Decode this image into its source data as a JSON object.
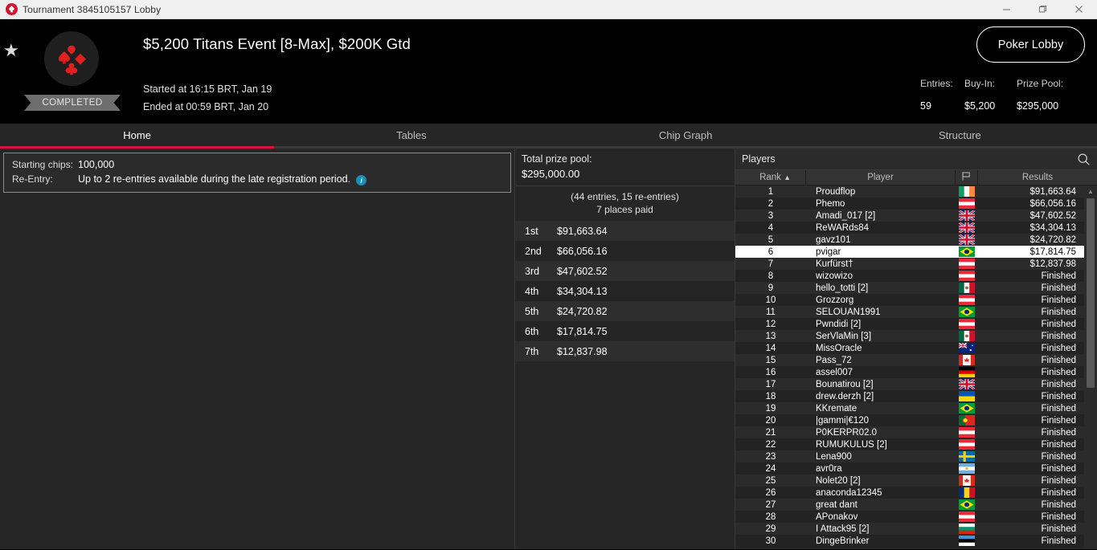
{
  "window": {
    "title": "Tournament 3845105157 Lobby",
    "logo_icon": "pokerstars-spade-icon",
    "controls": [
      {
        "name": "minimize-button",
        "icon": "minimize-icon"
      },
      {
        "name": "maximize-button",
        "icon": "maximize-icon"
      },
      {
        "name": "close-button",
        "icon": "close-icon"
      }
    ]
  },
  "header": {
    "favorite_icon": "star-icon",
    "logo_icon": "card-suits-icon",
    "status_badge": "COMPLETED",
    "title": "$5,200 Titans Event [8-Max], $200K Gtd",
    "started": "Started at 16:15 BRT, Jan 19",
    "ended": "Ended at 00:59 BRT, Jan 20",
    "lobby_button": "Poker Lobby",
    "stats": [
      {
        "label": "Entries:",
        "value": "59"
      },
      {
        "label": "Buy-In:",
        "value": "$5,200"
      },
      {
        "label": "Prize Pool:",
        "value": "$295,000"
      }
    ]
  },
  "tabs": [
    {
      "label": "Home",
      "active": true
    },
    {
      "label": "Tables",
      "active": false
    },
    {
      "label": "Chip Graph",
      "active": false
    },
    {
      "label": "Structure",
      "active": false
    }
  ],
  "info_panel": {
    "rows": [
      {
        "key": "Starting chips:",
        "value": "100,000",
        "info_icon": false
      },
      {
        "key": "Re-Entry:",
        "value": "Up to 2 re-entries available during the late registration period.",
        "info_icon": true
      }
    ],
    "info_icon_name": "info-icon",
    "info_icon_glyph": "i"
  },
  "prize_panel": {
    "total_label": "Total prize pool:",
    "total_value": "$295,000.00",
    "entries_line": "(44 entries, 15 re-entries)",
    "places_line": "7 places paid",
    "rows": [
      {
        "place": "1st",
        "amount": "$91,663.64"
      },
      {
        "place": "2nd",
        "amount": "$66,056.16"
      },
      {
        "place": "3rd",
        "amount": "$47,602.52"
      },
      {
        "place": "4th",
        "amount": "$34,304.13"
      },
      {
        "place": "5th",
        "amount": "$24,720.82"
      },
      {
        "place": "6th",
        "amount": "$17,814.75"
      },
      {
        "place": "7th",
        "amount": "$12,837.98"
      }
    ]
  },
  "players_panel": {
    "title": "Players",
    "search_icon": "search-icon",
    "columns": [
      {
        "label": "Rank",
        "sorted": "asc",
        "sort_icon": "chevron-up-icon"
      },
      {
        "label": "Player"
      },
      {
        "label": "",
        "icon": "flag-icon"
      },
      {
        "label": "Results"
      }
    ],
    "rows": [
      {
        "rank": "1",
        "player": "Proudflop",
        "country": "ie",
        "results": "$91,663.64",
        "selected": false
      },
      {
        "rank": "2",
        "player": "Phemo",
        "country": "at",
        "results": "$66,056.16",
        "selected": false
      },
      {
        "rank": "3",
        "player": "Amadi_017 [2]",
        "country": "gb",
        "results": "$47,602.52",
        "selected": false
      },
      {
        "rank": "4",
        "player": "ReWARds84",
        "country": "gb",
        "results": "$34,304.13",
        "selected": false
      },
      {
        "rank": "5",
        "player": "gavz101",
        "country": "gb",
        "results": "$24,720.82",
        "selected": false
      },
      {
        "rank": "6",
        "player": "pvigar",
        "country": "br",
        "results": "$17,814.75",
        "selected": true
      },
      {
        "rank": "7",
        "player": "Kurfürst†",
        "country": "at",
        "results": "$12,837.98",
        "selected": false
      },
      {
        "rank": "8",
        "player": "wizowizo",
        "country": "at",
        "results": "Finished",
        "selected": false
      },
      {
        "rank": "9",
        "player": "hello_totti [2]",
        "country": "mx",
        "results": "Finished",
        "selected": false
      },
      {
        "rank": "10",
        "player": "Grozzorg",
        "country": "at",
        "results": "Finished",
        "selected": false
      },
      {
        "rank": "11",
        "player": "SELOUAN1991",
        "country": "br",
        "results": "Finished",
        "selected": false
      },
      {
        "rank": "12",
        "player": "Pwndidi [2]",
        "country": "at",
        "results": "Finished",
        "selected": false
      },
      {
        "rank": "13",
        "player": "SerVlaMin [3]",
        "country": "mx",
        "results": "Finished",
        "selected": false
      },
      {
        "rank": "14",
        "player": "MissOracle",
        "country": "au",
        "results": "Finished",
        "selected": false
      },
      {
        "rank": "15",
        "player": "Pass_72",
        "country": "ca",
        "results": "Finished",
        "selected": false
      },
      {
        "rank": "16",
        "player": "assel007",
        "country": "de",
        "results": "Finished",
        "selected": false
      },
      {
        "rank": "17",
        "player": "Bounatirou [2]",
        "country": "gb",
        "results": "Finished",
        "selected": false
      },
      {
        "rank": "18",
        "player": "drew.derzh [2]",
        "country": "ua",
        "results": "Finished",
        "selected": false
      },
      {
        "rank": "19",
        "player": "KKremate",
        "country": "br",
        "results": "Finished",
        "selected": false
      },
      {
        "rank": "20",
        "player": "|gammi|€120",
        "country": "pt",
        "results": "Finished",
        "selected": false
      },
      {
        "rank": "21",
        "player": "P0KERPR02.0",
        "country": "at",
        "results": "Finished",
        "selected": false
      },
      {
        "rank": "22",
        "player": "RUMUKULUS [2]",
        "country": "at",
        "results": "Finished",
        "selected": false
      },
      {
        "rank": "23",
        "player": "Lena900",
        "country": "se",
        "results": "Finished",
        "selected": false
      },
      {
        "rank": "24",
        "player": "avr0ra",
        "country": "ar",
        "results": "Finished",
        "selected": false
      },
      {
        "rank": "25",
        "player": "Nolet20 [2]",
        "country": "ca",
        "results": "Finished",
        "selected": false
      },
      {
        "rank": "26",
        "player": "anaconda12345",
        "country": "ro",
        "results": "Finished",
        "selected": false
      },
      {
        "rank": "27",
        "player": "great dant",
        "country": "br",
        "results": "Finished",
        "selected": false
      },
      {
        "rank": "28",
        "player": "APonakov",
        "country": "at",
        "results": "Finished",
        "selected": false
      },
      {
        "rank": "29",
        "player": "I Attack95 [2]",
        "country": "bg",
        "results": "Finished",
        "selected": false
      },
      {
        "rank": "30",
        "player": "DingeBrinker",
        "country": "ee",
        "results": "Finished",
        "selected": false
      }
    ]
  },
  "colors": {
    "accent_red": "#d4123d",
    "suit_red": "#e41f1f",
    "info_blue": "#1a8fb5",
    "panel_bg": "#262626",
    "selected_row": "#ffffff"
  }
}
